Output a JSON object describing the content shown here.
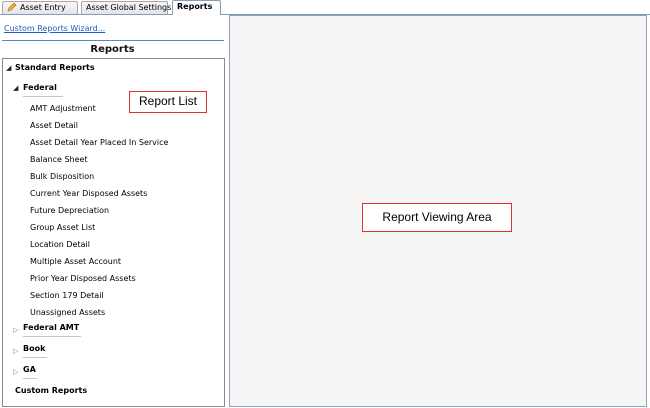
{
  "tabs": [
    {
      "label": "Asset Entry",
      "active": false
    },
    {
      "label": "Asset Global Settings",
      "active": false
    },
    {
      "label": "Reports",
      "active": true
    }
  ],
  "left": {
    "wizard_link": "Custom Reports Wizard...",
    "title": "Reports",
    "tree": {
      "standard": "Standard Reports",
      "federal": "Federal",
      "federal_items": [
        "AMT Adjustment",
        "Asset Detail",
        "Asset Detail Year Placed In Service",
        "Balance Sheet",
        "Bulk Disposition",
        "Current Year Disposed Assets",
        "Future Depreciation",
        "Group Asset List",
        "Location Detail",
        "Multiple Asset Account",
        "Prior Year Disposed Assets",
        "Section 179 Detail",
        "Unassigned Assets"
      ],
      "federal_amt": "Federal AMT",
      "book": "Book",
      "ga": "GA",
      "custom": "Custom Reports"
    }
  },
  "callouts": {
    "report_list": "Report List",
    "report_viewing_area": "Report Viewing Area"
  },
  "colors": {
    "callout_border": "#e03131",
    "link": "#1f5fbf",
    "view_background": "#f5f5f5"
  },
  "icons": {
    "asset_entry_tab": "pencil-icon",
    "expanded": "expanded-triangle-icon",
    "collapsed": "collapsed-triangle-icon"
  }
}
